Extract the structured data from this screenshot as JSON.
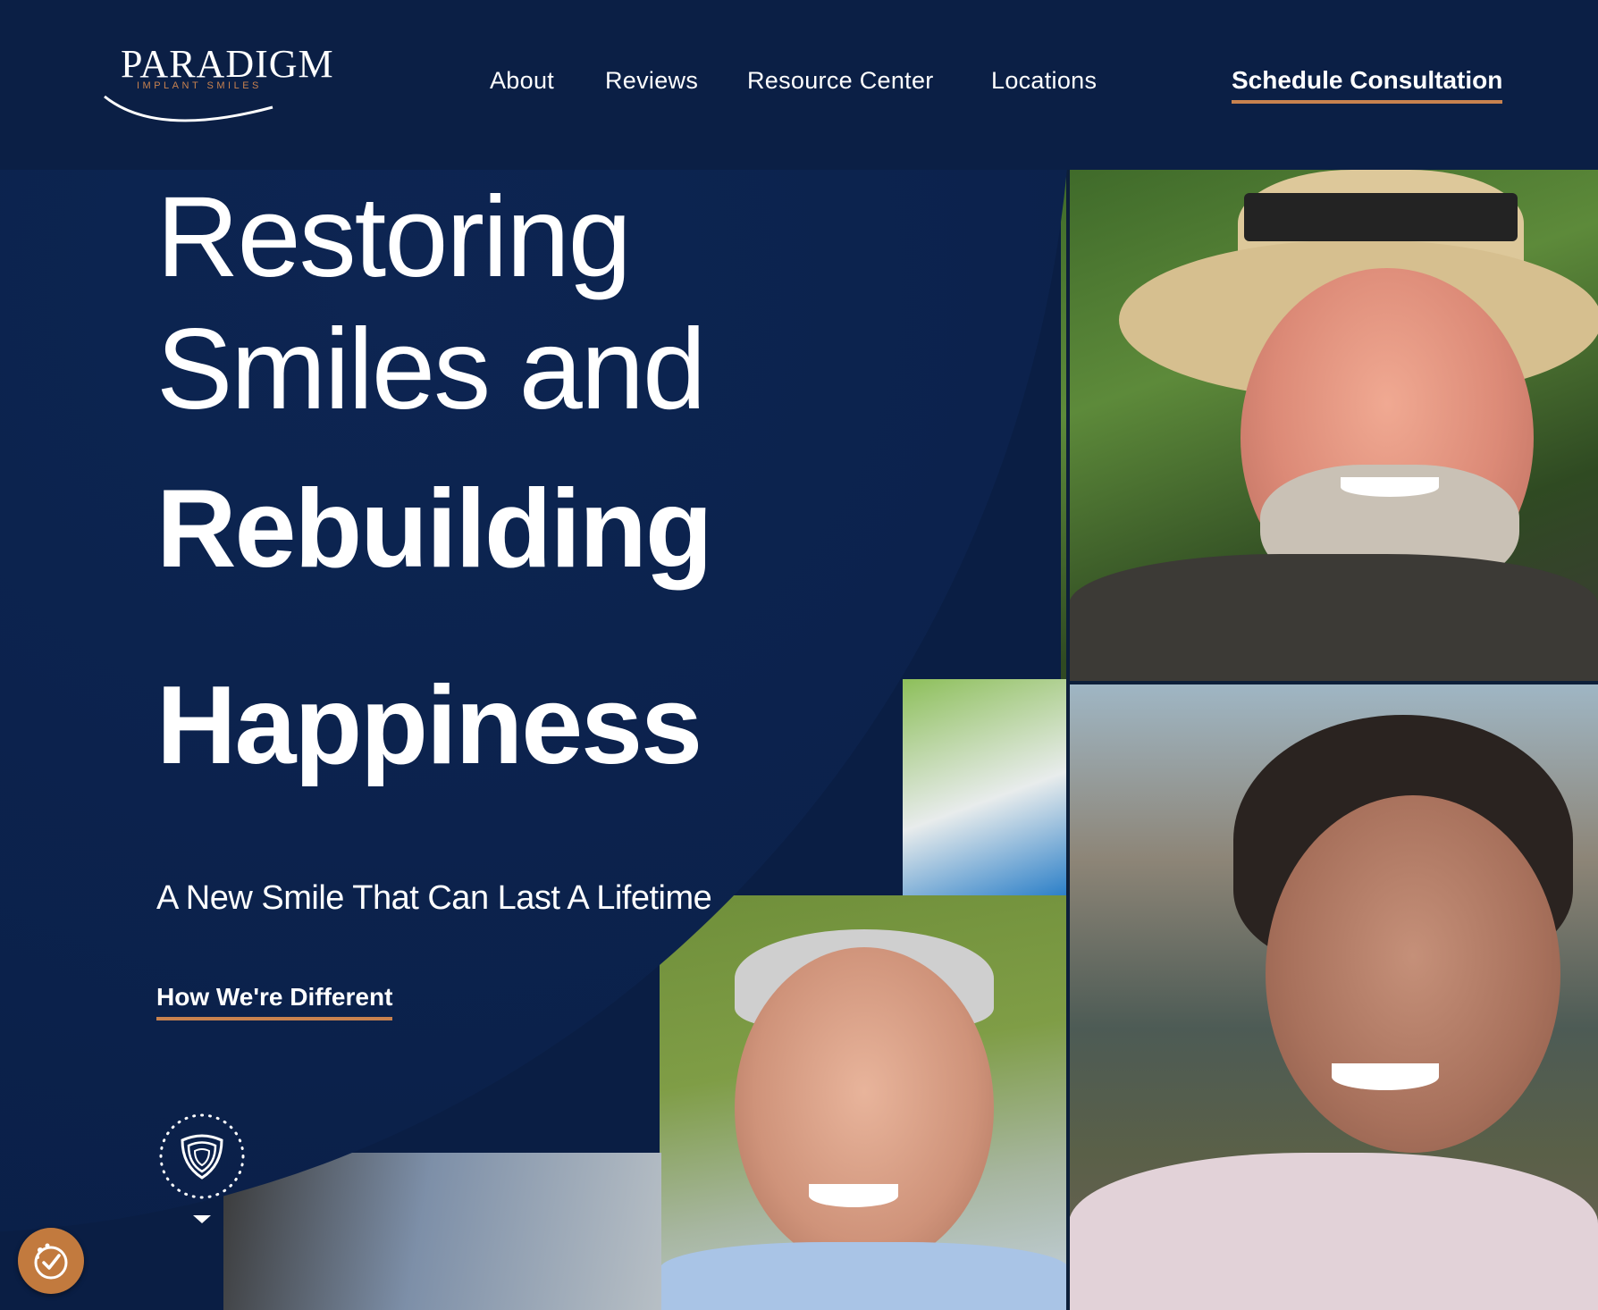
{
  "brand": {
    "name": "PARADIGM",
    "subtitle": "IMPLANT SMILES",
    "accent_color": "#c8824f",
    "navy_color": "#0b1f45"
  },
  "nav": {
    "items": [
      "About",
      "Reviews",
      "Resource Center",
      "Locations"
    ],
    "cta_label": "Schedule Consultation"
  },
  "hero": {
    "headline_lines": [
      "Restoring",
      "Smiles and",
      "Rebuilding",
      "Happiness"
    ],
    "tagline": "A New Smile That Can Last A Lifetime",
    "link_label": "How We're Different"
  },
  "icons": {
    "scroll_badge": "shield-icon",
    "scroll_arrow": "chevron-down-icon",
    "accessibility": "accessibility-icon"
  }
}
